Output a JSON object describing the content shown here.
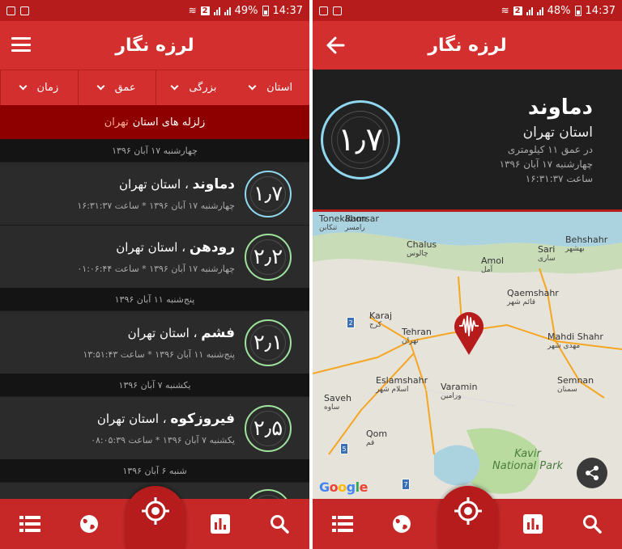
{
  "app_title": "لرزه نگار",
  "status_left": {
    "battery_pct": "49%",
    "time": "14:37"
  },
  "status_right": {
    "battery_pct": "48%",
    "time": "14:37"
  },
  "status_sim": "2",
  "filters": [
    {
      "label": "استان"
    },
    {
      "label": "بزرگی"
    },
    {
      "label": "عمق"
    },
    {
      "label": "زمان"
    }
  ],
  "region_banner": {
    "prefix": "زلزله های استان",
    "region": "تهران"
  },
  "list": [
    {
      "type": "date",
      "text": "چهارشنبه ۱۷ آبان ۱۳۹۶"
    },
    {
      "type": "quake",
      "city": "دماوند",
      "province": "، استان تهران",
      "meta": "چهارشنبه ۱۷ آبان ۱۳۹۶  *  ساعت ۱۶:۳۱:۳۷",
      "mag": "۱٫۷",
      "ring": "blue"
    },
    {
      "type": "quake",
      "city": "رودهن",
      "province": "، استان تهران",
      "meta": "چهارشنبه ۱۷ آبان ۱۳۹۶  *  ساعت ۰۱:۰۶:۴۴",
      "mag": "۲٫۲",
      "ring": "green"
    },
    {
      "type": "date",
      "text": "پنج‌شنبه ۱۱ آبان ۱۳۹۶"
    },
    {
      "type": "quake",
      "city": "فشم",
      "province": "، استان تهران",
      "meta": "پنج‌شنبه ۱۱ آبان ۱۳۹۶  *  ساعت ۱۳:۵۱:۴۳",
      "mag": "۲٫۱",
      "ring": "green"
    },
    {
      "type": "date",
      "text": "یکشنبه ۷ آبان ۱۳۹۶"
    },
    {
      "type": "quake",
      "city": "فیروزکوه",
      "province": "، استان تهران",
      "meta": "یکشنبه ۷ آبان ۱۳۹۶  *  ساعت ۰۸:۰۵:۳۹",
      "mag": "۲٫۵",
      "ring": "green"
    },
    {
      "type": "date",
      "text": "شنبه ۶ آبان ۱۳۹۶"
    }
  ],
  "detail": {
    "name": "دماوند",
    "province": "استان تهران",
    "depth": "در عمق ۱۱ کیلومتری",
    "date": "چهارشنبه ۱۷ آبان ۱۳۹۶",
    "time": "ساعت ۱۶:۳۱:۳۷",
    "mag": "۱٫۷"
  },
  "map": {
    "cities": [
      {
        "en": "Ramsar",
        "fa": "رامسر"
      },
      {
        "en": "Chalus",
        "fa": "چالوس"
      },
      {
        "en": "Amol",
        "fa": "آمل"
      },
      {
        "en": "Sari",
        "fa": "ساری"
      },
      {
        "en": "Behshahr",
        "fa": "بهشهر"
      },
      {
        "en": "Qaemshahr",
        "fa": "قائم شهر"
      },
      {
        "en": "Karaj",
        "fa": "کرج"
      },
      {
        "en": "Tehran",
        "fa": "تهران"
      },
      {
        "en": "Mahdi Shahr",
        "fa": "مهدی شهر"
      },
      {
        "en": "Semnan",
        "fa": "سمنان"
      },
      {
        "en": "Eslamshahr",
        "fa": "اسلام شهر"
      },
      {
        "en": "Varamin",
        "fa": "ورامین"
      },
      {
        "en": "Saveh",
        "fa": "ساوه"
      },
      {
        "en": "Qom",
        "fa": "قم"
      },
      {
        "en": "Tonekabon",
        "fa": "تنکابن"
      }
    ],
    "park_line1": "Kavir",
    "park_line2": "National Park",
    "google": [
      "G",
      "o",
      "o",
      "g",
      "l",
      "e"
    ],
    "road_numbers": [
      "2",
      "5",
      "7"
    ]
  },
  "colors": {
    "appbar": "#d32f2f",
    "dark_red": "#8e0000",
    "ring_blue": "#8fd8ef",
    "ring_green": "#9ee29e",
    "sea": "#aad3df",
    "park": "#b9dba0"
  },
  "nav_icons_left": [
    "list-icon",
    "globe-icon",
    "location-icon",
    "chart-icon",
    "search-icon"
  ],
  "nav_icons_right": [
    "list-icon",
    "globe-icon",
    "location-icon",
    "chart-icon",
    "search-icon"
  ]
}
